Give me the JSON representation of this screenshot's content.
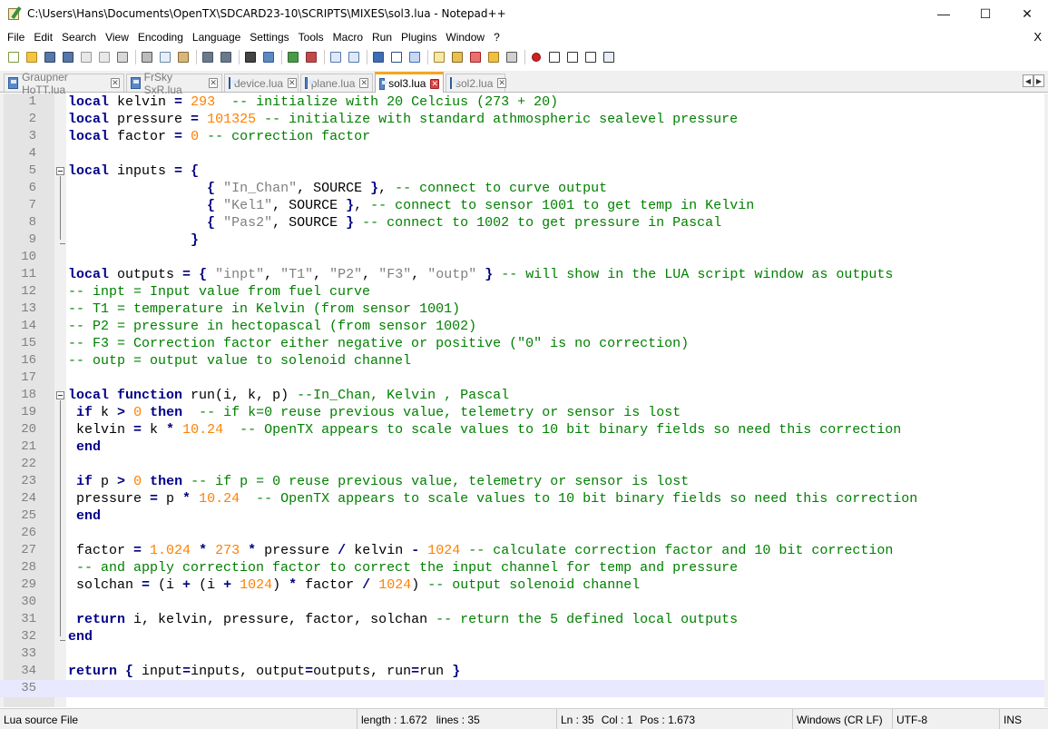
{
  "window": {
    "title": "C:\\Users\\Hans\\Documents\\OpenTX\\SDCARD23-10\\SCRIPTS\\MIXES\\sol3.lua - Notepad++",
    "minimize": "—",
    "maximize": "☐",
    "close": "✕"
  },
  "menu": {
    "items": [
      "File",
      "Edit",
      "Search",
      "View",
      "Encoding",
      "Language",
      "Settings",
      "Tools",
      "Macro",
      "Run",
      "Plugins",
      "Window",
      "?"
    ],
    "close_doc": "X"
  },
  "toolbar": {
    "icons": [
      "new-file-icon",
      "open-file-icon",
      "save-icon",
      "save-all-icon",
      "close-icon",
      "close-all-icon",
      "print-icon",
      "cut-icon",
      "copy-icon",
      "paste-icon",
      "undo-icon",
      "redo-icon",
      "find-icon",
      "replace-icon",
      "zoom-in-icon",
      "zoom-out-icon",
      "sync-vertical-icon",
      "sync-horizontal-icon",
      "word-wrap-icon",
      "show-all-chars-icon",
      "indent-guide-icon",
      "lang-icon",
      "doc-map-icon",
      "function-list-icon",
      "folder-workspace-icon",
      "monitor-icon",
      "record-macro-icon",
      "stop-macro-icon",
      "play-macro-icon",
      "run-macro-multiple-icon",
      "save-macro-icon"
    ]
  },
  "tabs": [
    {
      "label": "Graupner HoTT.lua",
      "active": false
    },
    {
      "label": "FrSky SxR.lua",
      "active": false
    },
    {
      "label": "device.lua",
      "active": false
    },
    {
      "label": "plane.lua",
      "active": false
    },
    {
      "label": "sol3.lua",
      "active": true
    },
    {
      "label": "sol2.lua",
      "active": false
    }
  ],
  "tab_nav": {
    "prev": "◀",
    "next": "▶"
  },
  "tab_close_glyph": "✕",
  "editor": {
    "current_line": 35,
    "lines": [
      {
        "n": "1",
        "code": "local kelvin = 293  -- initialize with 20 Celcius (273 + 20)"
      },
      {
        "n": "2",
        "code": "local pressure = 101325 -- initialize with standard athmospheric sealevel pressure"
      },
      {
        "n": "3",
        "code": "local factor = 0 -- correction factor"
      },
      {
        "n": "4",
        "code": ""
      },
      {
        "n": "5",
        "code": "local inputs = {"
      },
      {
        "n": "6",
        "code": "                 { \"In_Chan\", SOURCE }, -- connect to curve output"
      },
      {
        "n": "7",
        "code": "                 { \"Kel1\", SOURCE }, -- connect to sensor 1001 to get temp in Kelvin"
      },
      {
        "n": "8",
        "code": "                 { \"Pas2\", SOURCE } -- connect to 1002 to get pressure in Pascal"
      },
      {
        "n": "9",
        "code": "               }"
      },
      {
        "n": "10",
        "code": ""
      },
      {
        "n": "11",
        "code": "local outputs = { \"inpt\", \"T1\", \"P2\", \"F3\", \"outp\" } -- will show in the LUA script window as outputs"
      },
      {
        "n": "12",
        "code": "-- inpt = Input value from fuel curve"
      },
      {
        "n": "13",
        "code": "-- T1 = temperature in Kelvin (from sensor 1001)"
      },
      {
        "n": "14",
        "code": "-- P2 = pressure in hectopascal (from sensor 1002)"
      },
      {
        "n": "15",
        "code": "-- F3 = Correction factor either negative or positive (\"0\" is no correction)"
      },
      {
        "n": "16",
        "code": "-- outp = output value to solenoid channel"
      },
      {
        "n": "17",
        "code": ""
      },
      {
        "n": "18",
        "code": "local function run(i, k, p) --In_Chan, Kelvin , Pascal"
      },
      {
        "n": "19",
        "code": " if k > 0 then  -- if k=0 reuse previous value, telemetry or sensor is lost"
      },
      {
        "n": "20",
        "code": " kelvin = k * 10.24  -- OpenTX appears to scale values to 10 bit binary fields so need this correction"
      },
      {
        "n": "21",
        "code": " end"
      },
      {
        "n": "22",
        "code": ""
      },
      {
        "n": "23",
        "code": " if p > 0 then -- if p = 0 reuse previous value, telemetry or sensor is lost"
      },
      {
        "n": "24",
        "code": " pressure = p * 10.24  -- OpenTX appears to scale values to 10 bit binary fields so need this correction"
      },
      {
        "n": "25",
        "code": " end"
      },
      {
        "n": "26",
        "code": ""
      },
      {
        "n": "27",
        "code": " factor = 1.024 * 273 * pressure / kelvin - 1024 -- calculate correction factor and 10 bit correction"
      },
      {
        "n": "28",
        "code": " -- and apply correction factor to correct the input channel for temp and pressure"
      },
      {
        "n": "29",
        "code": " solchan = (i + (i + 1024) * factor / 1024) -- output solenoid channel"
      },
      {
        "n": "30",
        "code": ""
      },
      {
        "n": "31",
        "code": " return i, kelvin, pressure, factor, solchan -- return the 5 defined local outputs"
      },
      {
        "n": "32",
        "code": "end"
      },
      {
        "n": "33",
        "code": ""
      },
      {
        "n": "34",
        "code": "return { input=inputs, output=outputs, run=run }"
      },
      {
        "n": "35",
        "code": ""
      }
    ]
  },
  "status": {
    "filetype": "Lua source File",
    "length": "length : 1.672",
    "lines": "lines : 35",
    "ln": "Ln : 35",
    "col": "Col : 1",
    "pos": "Pos : 1.673",
    "eol": "Windows (CR LF)",
    "encoding": "UTF-8",
    "mode": "INS"
  }
}
